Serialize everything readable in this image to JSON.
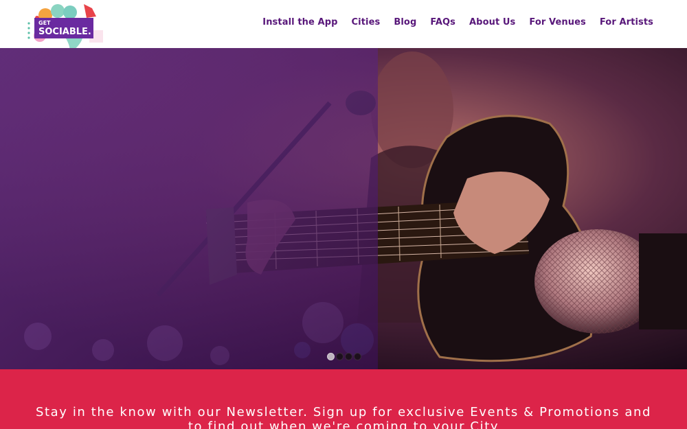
{
  "brand": {
    "logo_small_text": "GET",
    "logo_main_text": "SOCIABLE."
  },
  "nav": {
    "install_app": "Install the App",
    "cities": "Cities",
    "blog": "Blog",
    "faqs": "FAQs",
    "about_us": "About Us",
    "for_venues": "For Venues",
    "for_artists": "For Artists"
  },
  "hero": {
    "slider_dot_count": 4,
    "active_slide_index": 0
  },
  "newsletter": {
    "text": "Stay in the know with our Newsletter. Sign up for exclusive Events & Promotions and to find out when we're coming to your City"
  },
  "colors": {
    "nav_text": "#58177a",
    "newsletter_bg": "#dc2449",
    "hero_overlay": "#6a2a8c"
  }
}
